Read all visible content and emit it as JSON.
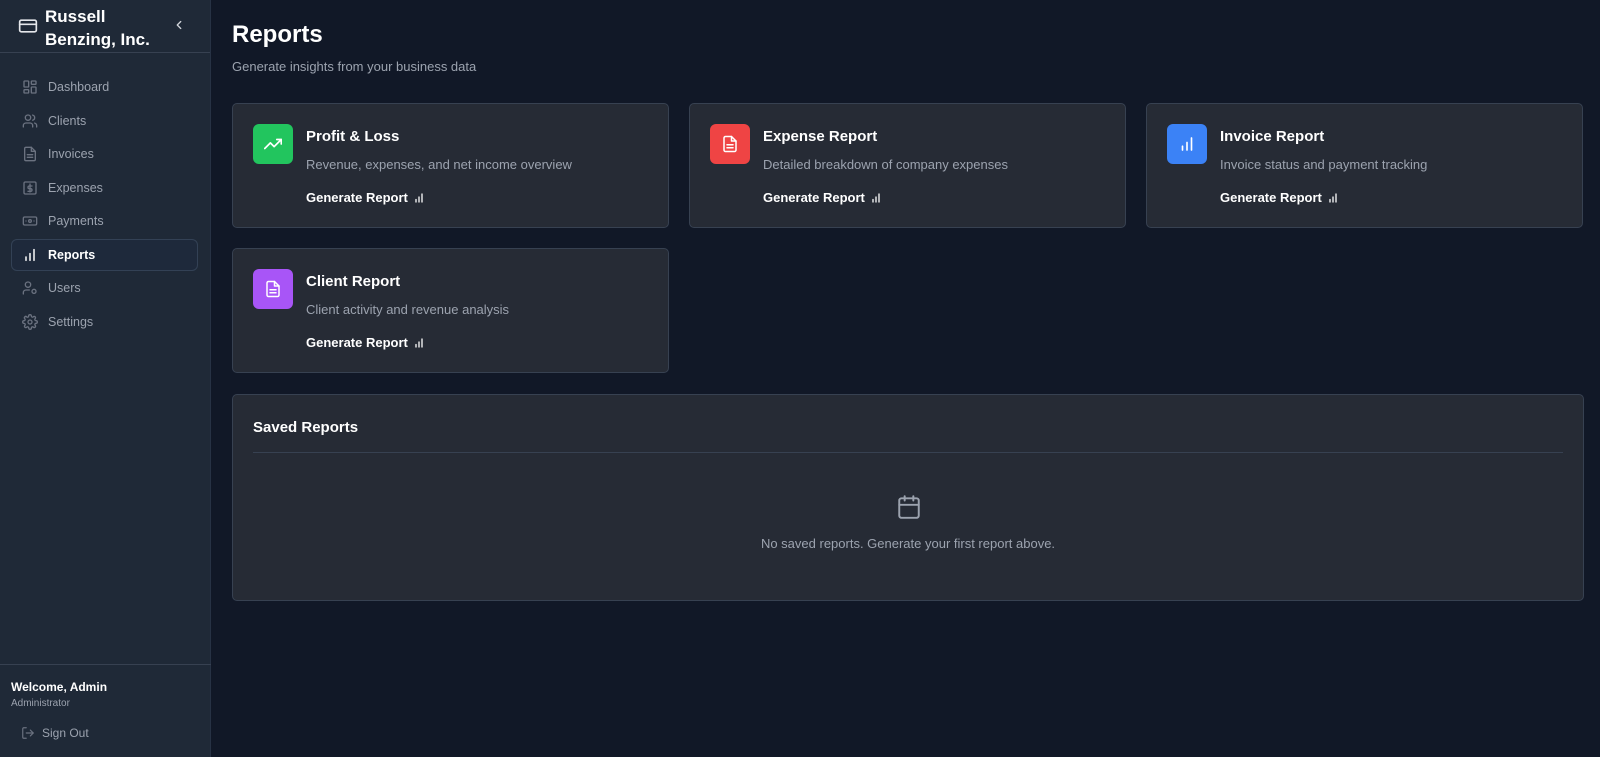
{
  "sidebar": {
    "company": "Russell Benzing, Inc.",
    "items": [
      {
        "label": "Dashboard",
        "icon": "grid-icon"
      },
      {
        "label": "Clients",
        "icon": "users-icon"
      },
      {
        "label": "Invoices",
        "icon": "file-icon"
      },
      {
        "label": "Expenses",
        "icon": "dollar-icon"
      },
      {
        "label": "Payments",
        "icon": "banknote-icon"
      },
      {
        "label": "Reports",
        "icon": "bar-chart-icon",
        "active": true
      },
      {
        "label": "Users",
        "icon": "user-cog-icon"
      },
      {
        "label": "Settings",
        "icon": "gear-icon"
      }
    ],
    "welcome": "Welcome, Admin",
    "role": "Administrator",
    "sign_out": "Sign Out"
  },
  "header": {
    "title": "Reports",
    "subtitle": "Generate insights from your business data"
  },
  "reports": [
    {
      "title": "Profit & Loss",
      "description": "Revenue, expenses, and net income overview",
      "action": "Generate Report",
      "icon": "trending-up-icon",
      "color": "#22c55e"
    },
    {
      "title": "Expense Report",
      "description": "Detailed breakdown of company expenses",
      "action": "Generate Report",
      "icon": "file-text-icon",
      "color": "#ef4444"
    },
    {
      "title": "Invoice Report",
      "description": "Invoice status and payment tracking",
      "action": "Generate Report",
      "icon": "bar-chart-icon",
      "color": "#3b82f6"
    },
    {
      "title": "Client Report",
      "description": "Client activity and revenue analysis",
      "action": "Generate Report",
      "icon": "file-text-icon",
      "color": "#a855f7"
    }
  ],
  "saved_reports": {
    "title": "Saved Reports",
    "empty_message": "No saved reports. Generate your first report above.",
    "empty_icon": "calendar-icon"
  },
  "colors": {
    "background": "#111827",
    "sidebar": "#1f2937",
    "card": "#262b35",
    "border": "#374151"
  }
}
